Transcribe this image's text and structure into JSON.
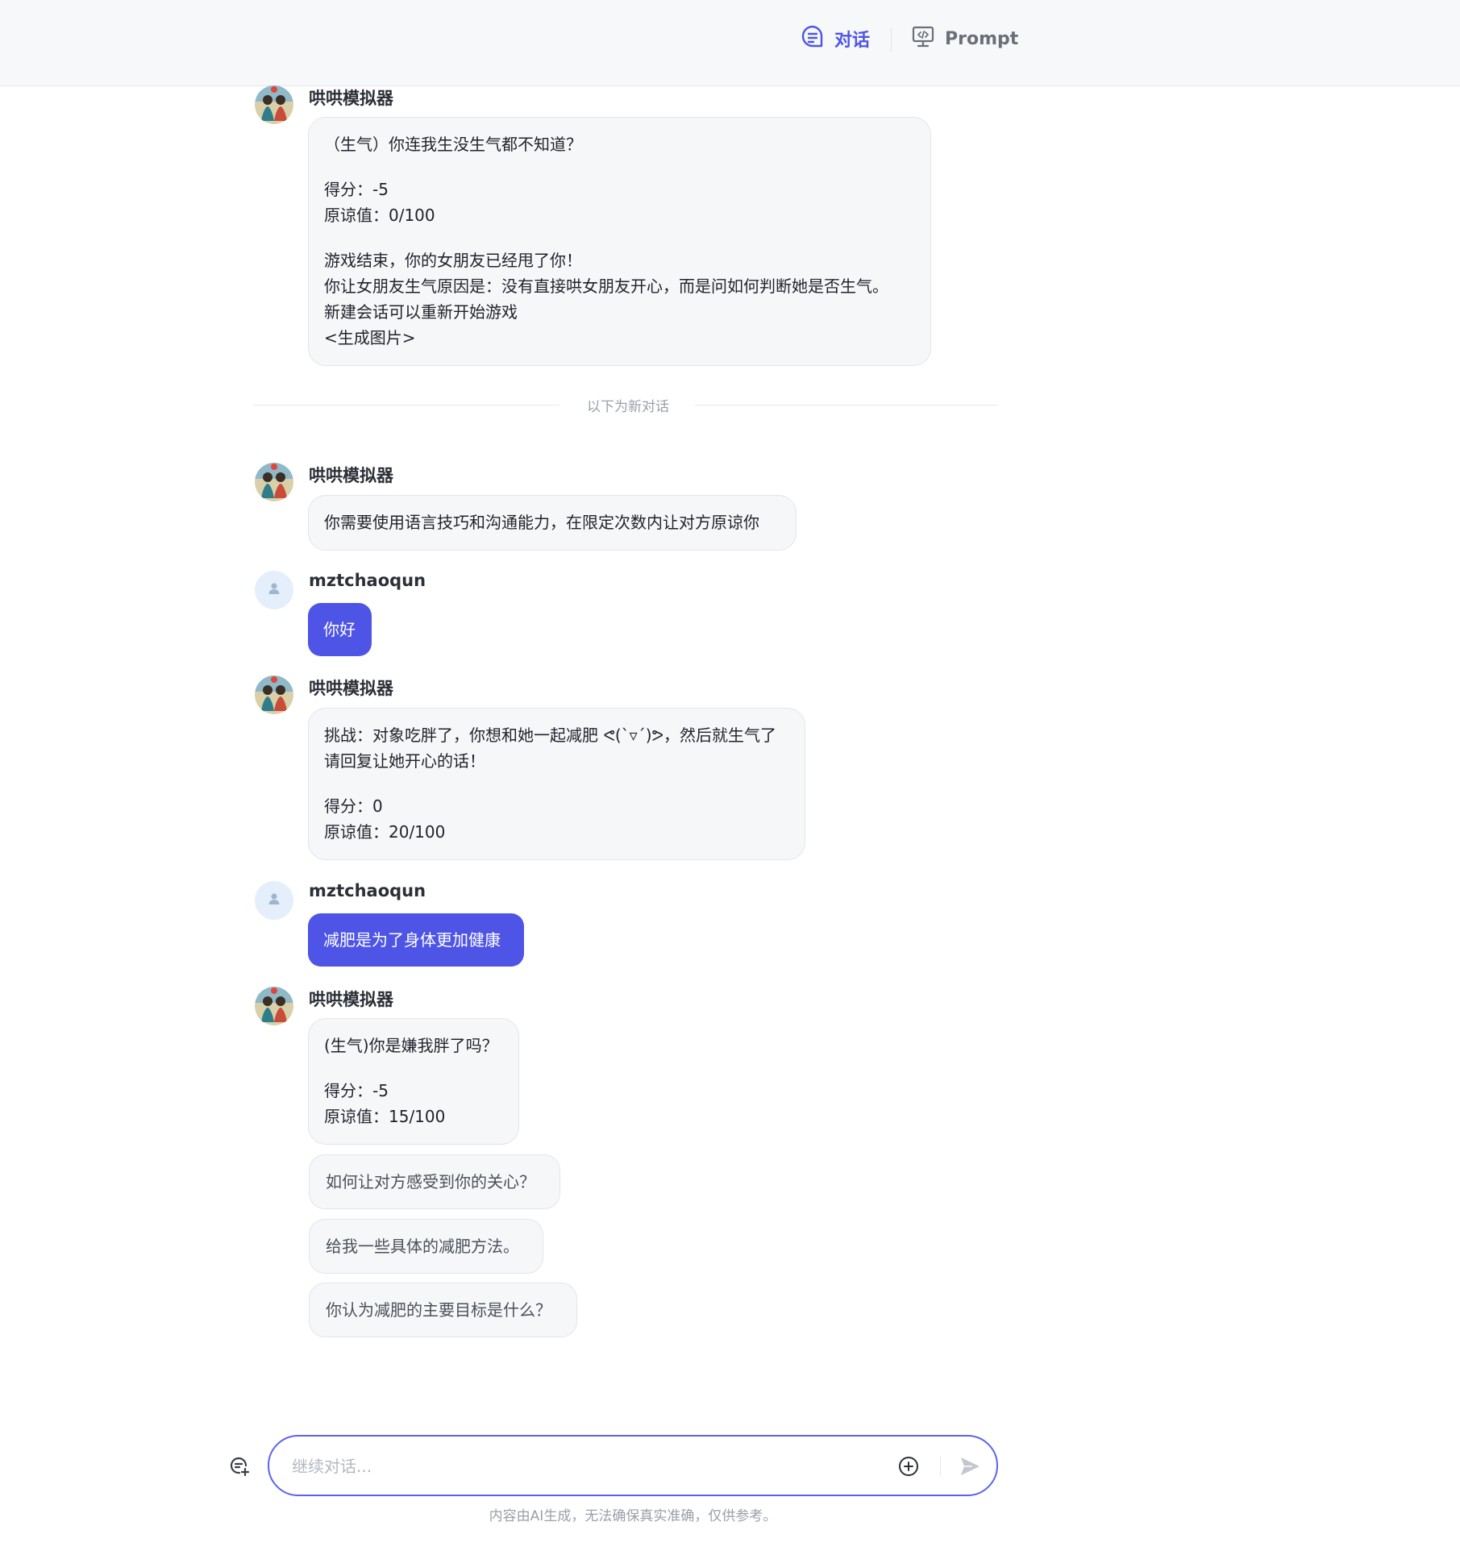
{
  "header": {
    "tabs": [
      {
        "label": "对话",
        "active": true
      },
      {
        "label": "Prompt",
        "active": false
      }
    ]
  },
  "colors": {
    "accent": "#4e55e6",
    "bubble_bg": "#f6f7f9",
    "header_bg": "#f7f8fa"
  },
  "messages": {
    "m1": {
      "name": "哄哄模拟器",
      "lines_a": [
        "（生气）你连我生没生气都不知道？"
      ],
      "lines_b": [
        "得分：-5",
        "原谅值：0/100"
      ],
      "lines_c": [
        "游戏结束，你的女朋友已经甩了你！",
        "你让女朋友生气原因是：没有直接哄女朋友开心，而是问如何判断她是否生气。",
        "新建会话可以重新开始游戏",
        "<生成图片>"
      ]
    },
    "divider": "以下为新对话",
    "m2": {
      "name": "哄哄模拟器",
      "text": "你需要使用语言技巧和沟通能力，在限定次数内让对方原谅你"
    },
    "m3": {
      "name": "mztchaoqun",
      "text": "你好"
    },
    "m4": {
      "name": "哄哄模拟器",
      "lines_a": [
        "挑战：对象吃胖了，你想和她一起减肥 ᕙ(`▿´)ᕗ，然后就生气了",
        "请回复让她开心的话！"
      ],
      "lines_b": [
        "得分：0",
        "原谅值：20/100"
      ]
    },
    "m5": {
      "name": "mztchaoqun",
      "text": "减肥是为了身体更加健康"
    },
    "m6": {
      "name": "哄哄模拟器",
      "lines_a": [
        "(生气)你是嫌我胖了吗？"
      ],
      "lines_b": [
        "得分：-5",
        "原谅值：15/100"
      ]
    }
  },
  "suggestions": [
    "如何让对方感受到你的关心？",
    "给我一些具体的减肥方法。",
    "你认为减肥的主要目标是什么？"
  ],
  "input": {
    "placeholder": "继续对话...",
    "value": ""
  },
  "footer_note": "内容由AI生成，无法确保真实准确，仅供参考。"
}
